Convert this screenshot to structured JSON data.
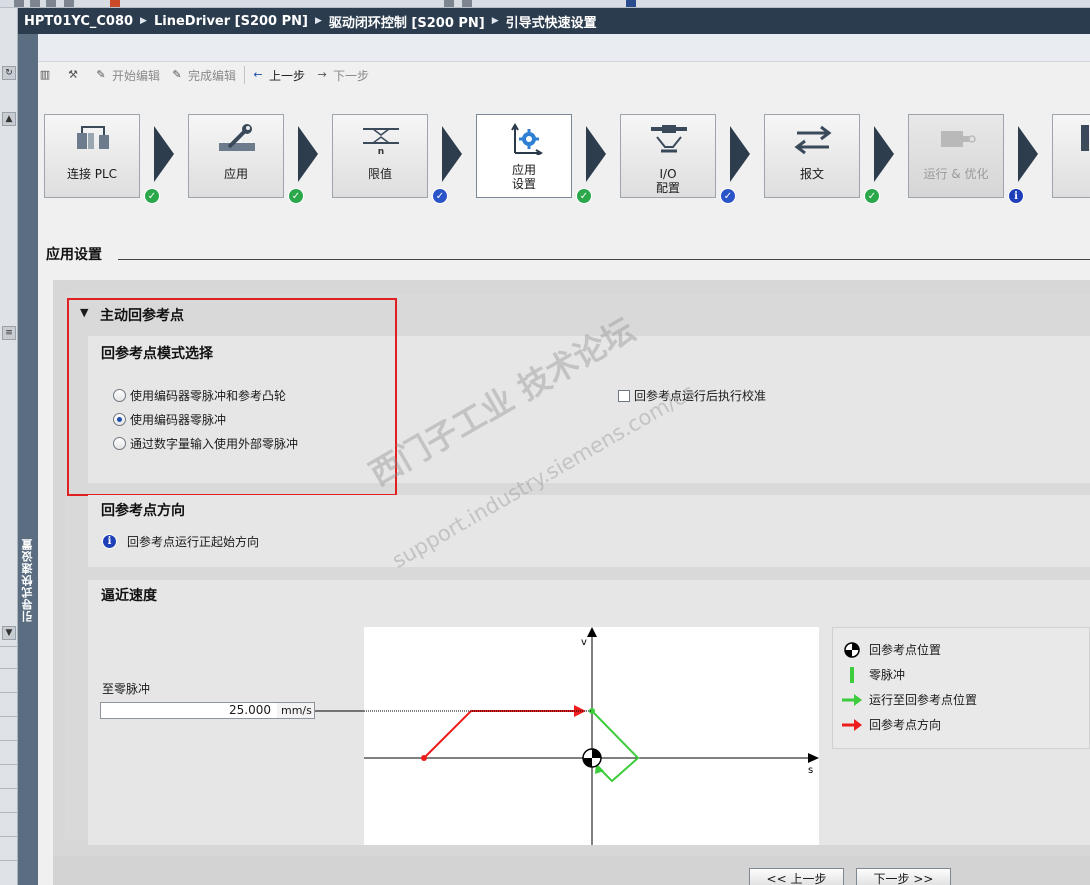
{
  "breadcrumb": [
    "HPT01YC_C080",
    "LineDriver [S200 PN]",
    "驱动闭环控制 [S200 PN]",
    "引导式快速设置"
  ],
  "side_tab_label": "引导式快速设置",
  "toolbar": {
    "start_edit": "开始编辑",
    "finish_edit": "完成编辑",
    "prev": "上一步",
    "next": "下一步"
  },
  "wizard_steps": [
    {
      "label": "连接 PLC",
      "status": "done",
      "icon": "plc-connection-icon"
    },
    {
      "label": "应用",
      "status": "done",
      "icon": "wrench-ruler-icon"
    },
    {
      "label": "限值",
      "status": "configured",
      "icon": "limits-icon",
      "sub": "n"
    },
    {
      "label": "应用\n设置",
      "status": "done",
      "icon": "axis-gear-icon",
      "active": true
    },
    {
      "label": "I/O\n配置",
      "status": "configured",
      "icon": "io-connector-icon"
    },
    {
      "label": "报文",
      "status": "done",
      "icon": "telegram-arrows-icon"
    },
    {
      "label": "运行 & 优化",
      "status": "info",
      "icon": "motor-icon",
      "disabled": true
    },
    {
      "label": "",
      "status": "none",
      "icon": "next-step-icon"
    }
  ],
  "section_title": "应用设置",
  "homing": {
    "title": "主动回参考点",
    "mode_title": "回参考点模式选择",
    "options": [
      {
        "label": "使用编码器零脉冲和参考凸轮",
        "selected": false
      },
      {
        "label": "使用编码器零脉冲",
        "selected": true
      },
      {
        "label": "通过数字量输入使用外部零脉冲",
        "selected": false
      }
    ],
    "calibrate_label": "回参考点运行后执行校准",
    "calibrate_checked": false
  },
  "direction": {
    "title": "回参考点方向",
    "text": "回参考点运行正起始方向"
  },
  "approach": {
    "title": "逼近速度",
    "field_label": "至零脉冲",
    "value": "25.000",
    "unit": "mm/s",
    "axis_v": "v",
    "axis_s": "s"
  },
  "legend": [
    {
      "label": "回参考点位置",
      "symbol": "reference-point-icon"
    },
    {
      "label": "零脉冲",
      "symbol": "zero-pulse-icon",
      "color": "#3ccc3c"
    },
    {
      "label": "运行至回参考点位置",
      "symbol": "green-arrow-icon",
      "color": "#3ccc3c"
    },
    {
      "label": "回参考点方向",
      "symbol": "red-arrow-icon",
      "color": "#ee1c1c"
    }
  ],
  "nav": {
    "prev": "<< 上一步",
    "next": "下一步 >>"
  },
  "watermark": {
    "line1": "西门子工业 技术论坛",
    "line2": "support.industry.siemens.com/cs"
  },
  "colors": {
    "breadcrumb_bg": "#2b3c4e",
    "highlight_box": "#e02020",
    "status_green": "#2aa84a",
    "status_blue": "#2a55c8"
  }
}
